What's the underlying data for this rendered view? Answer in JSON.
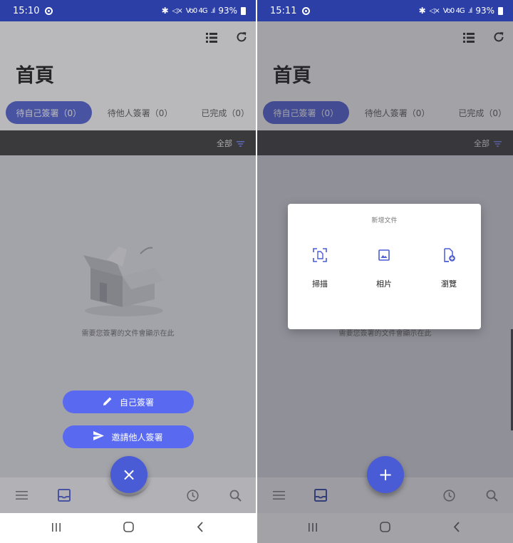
{
  "screens": [
    {
      "status": {
        "time": "15:10",
        "signal_text": "Vo0 4G",
        "battery": "93%"
      },
      "title": "首頁",
      "tabs": [
        "待自己簽署（0）",
        "待他人簽署（0）",
        "已完成（0）"
      ],
      "filter_label": "全部",
      "empty_message": "需要您簽署的文件會顯示在此",
      "actions": {
        "self_sign": "自己簽署",
        "invite_sign": "邀請他人簽署"
      },
      "fab_symbol": "×"
    },
    {
      "status": {
        "time": "15:11",
        "signal_text": "Vo0 4G",
        "battery": "93%"
      },
      "title": "首頁",
      "tabs": [
        "待自己簽署（0）",
        "待他人簽署（0）",
        "已完成（0）"
      ],
      "filter_label": "全部",
      "empty_message": "需要您簽署的文件會顯示在此",
      "dialog": {
        "title": "新增文件",
        "options": [
          "掃描",
          "相片",
          "瀏覽"
        ]
      },
      "fab_symbol": "+"
    }
  ],
  "colors": {
    "accent": "#4a5bd6",
    "status_bar": "#2b3fa6",
    "filter_bar": "#333333"
  },
  "icons": [
    "list-icon",
    "refresh-icon",
    "filter-icon",
    "menu-icon",
    "inbox-icon",
    "history-icon",
    "search-icon",
    "pencil-icon",
    "send-icon",
    "scan-icon",
    "photo-icon",
    "browse-file-icon",
    "recent-apps-icon",
    "home-icon",
    "back-icon"
  ]
}
